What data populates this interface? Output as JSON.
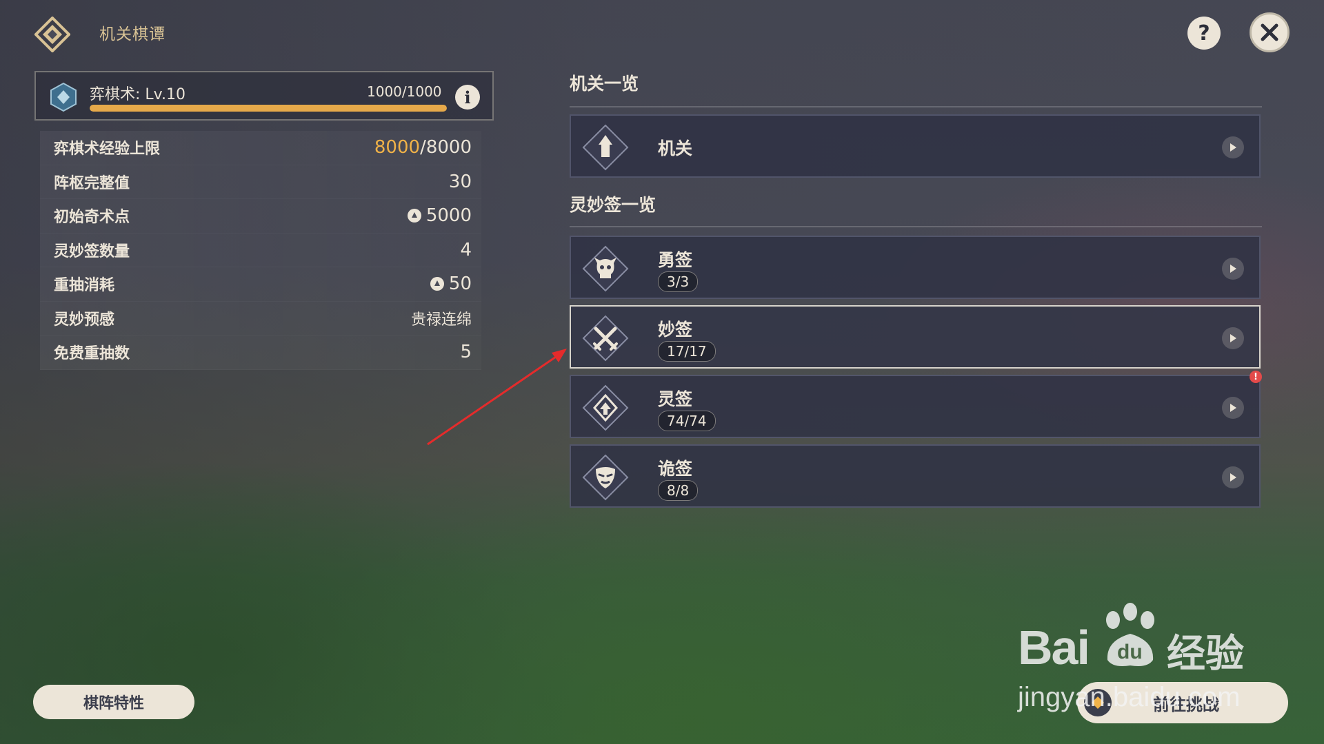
{
  "header": {
    "title": "机关棋谭"
  },
  "level": {
    "label": "弈棋术: Lv.10",
    "xp_text": "1000/1000",
    "progress": 1.0
  },
  "stats": [
    {
      "label": "弈棋术经验上限",
      "value_hi": "8000",
      "value_rest": "/8000",
      "coin": false
    },
    {
      "label": "阵枢完整值",
      "value_hi": "",
      "value_rest": "30",
      "coin": false
    },
    {
      "label": "初始奇术点",
      "value_hi": "",
      "value_rest": "5000",
      "coin": true
    },
    {
      "label": "灵妙签数量",
      "value_hi": "",
      "value_rest": "4",
      "coin": false
    },
    {
      "label": "重抽消耗",
      "value_hi": "",
      "value_rest": "50",
      "coin": true
    },
    {
      "label": "灵妙预感",
      "value_hi": "",
      "value_rest": "贵禄连绵",
      "coin": false
    },
    {
      "label": "免费重抽数",
      "value_hi": "",
      "value_rest": "5",
      "coin": false
    }
  ],
  "sections": {
    "mechanisms_title": "机关一览",
    "signs_title": "灵妙签一览"
  },
  "mechanism_card": {
    "name": "机关"
  },
  "sign_cards": [
    {
      "name": "勇签",
      "count": "3/3",
      "icon": "skull-icon"
    },
    {
      "name": "妙签",
      "count": "17/17",
      "icon": "crossed-swords-icon"
    },
    {
      "name": "灵签",
      "count": "74/74",
      "icon": "arrow-up-icon"
    },
    {
      "name": "诡签",
      "count": "8/8",
      "icon": "mask-icon"
    }
  ],
  "bottom": {
    "traits_label": "棋阵特性",
    "go_label": "前往挑战"
  },
  "watermark": {
    "brand": "Bai",
    "brand_cn": "经验",
    "url": "jingyan.baidu.com"
  },
  "colors": {
    "accent": "#f0b248",
    "panel": "#303244",
    "text": "#ece5d8",
    "title_gold": "#d9c395"
  }
}
